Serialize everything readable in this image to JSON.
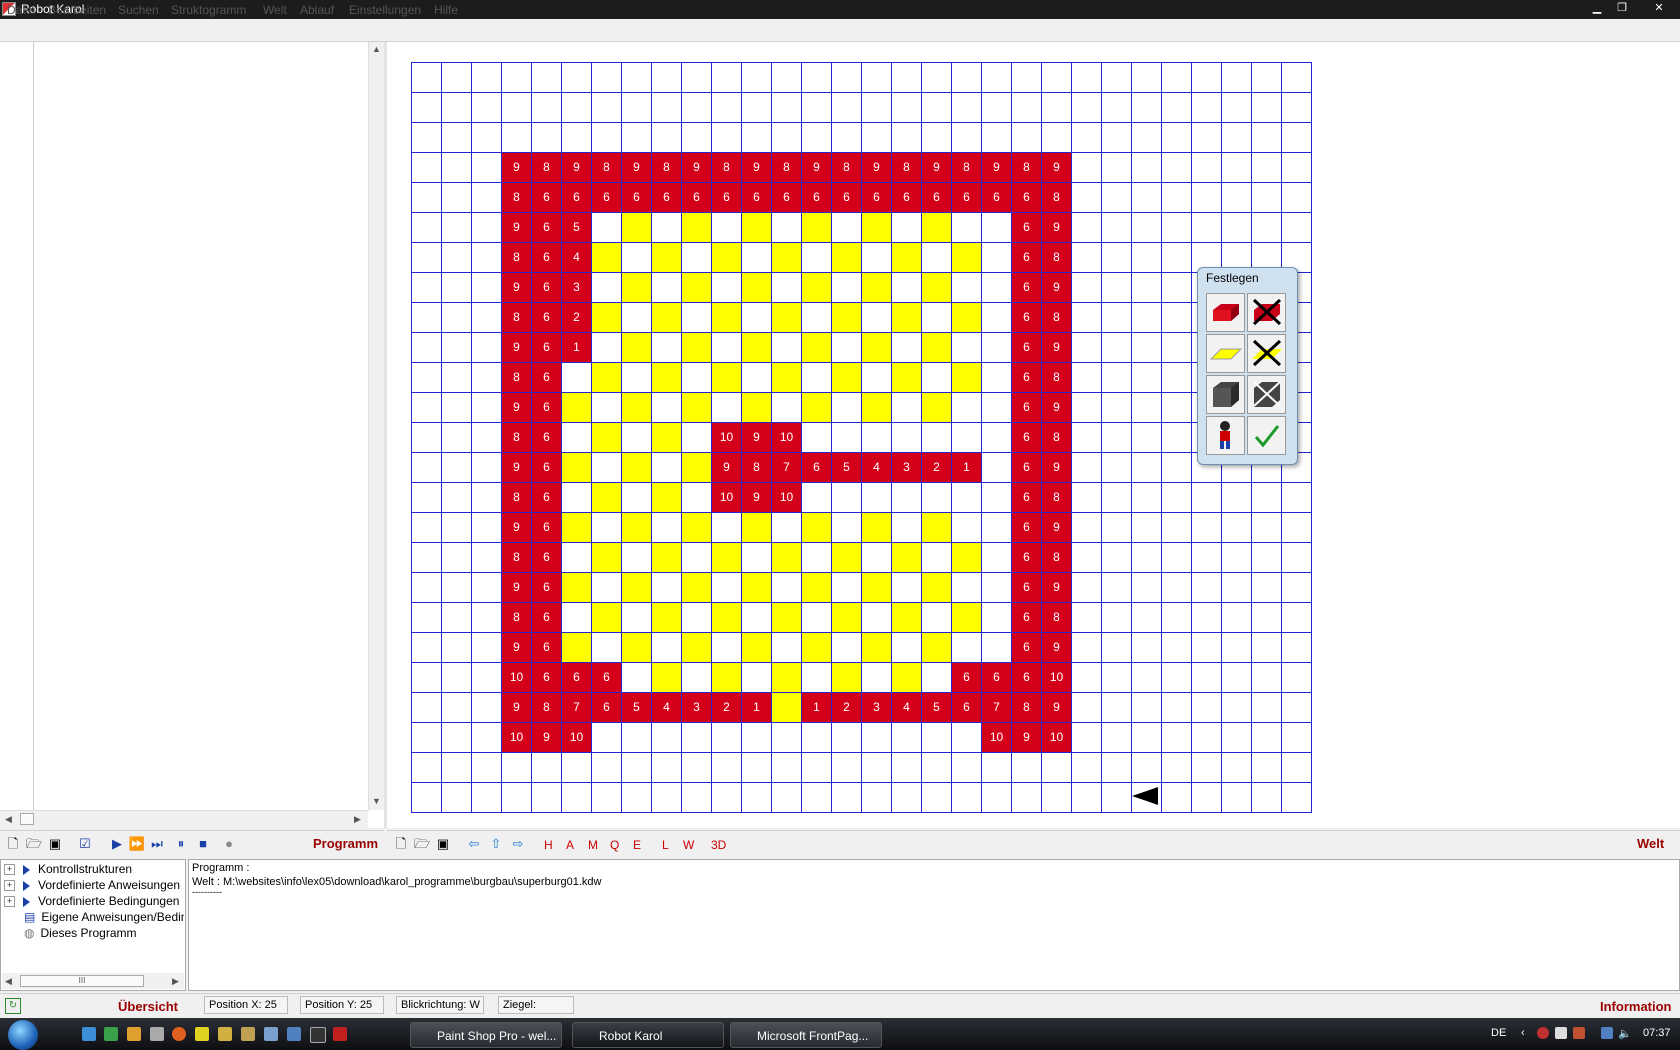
{
  "window": {
    "title": "Robot Karol",
    "min": "▁",
    "max": "❐",
    "close": "✕"
  },
  "menu": [
    "Datei",
    "Bearbeiten",
    "Suchen",
    "Struktogramm",
    "Welt",
    "Ablauf",
    "Einstellungen",
    "Hilfe"
  ],
  "world": {
    "cols": 30,
    "rows": 25,
    "grid_color": "#2424d0",
    "brick_color": "#d4001a",
    "mark_color": "#ffff00",
    "bricks": [
      {
        "row": 3,
        "values": [
          "9",
          "8",
          "9",
          "8",
          "9",
          "8",
          "9",
          "8",
          "9",
          "8",
          "9",
          "8",
          "9",
          "8",
          "9",
          "8",
          "9",
          "8",
          "9"
        ]
      },
      {
        "row": 4,
        "values": [
          "8",
          "6",
          "6",
          "6",
          "6",
          "6",
          "6",
          "6",
          "6",
          "6",
          "6",
          "6",
          "6",
          "6",
          "6",
          "6",
          "6",
          "6",
          "8"
        ]
      },
      {
        "row": 5,
        "left": [
          "9",
          "6",
          "5"
        ],
        "right": [
          "6",
          "9"
        ]
      },
      {
        "row": 6,
        "left": [
          "8",
          "6",
          "4"
        ],
        "right": [
          "6",
          "8"
        ]
      },
      {
        "row": 7,
        "left": [
          "9",
          "6",
          "3"
        ],
        "right": [
          "6",
          "9"
        ]
      },
      {
        "row": 8,
        "left": [
          "8",
          "6",
          "2"
        ],
        "right": [
          "6",
          "8"
        ]
      },
      {
        "row": 9,
        "left": [
          "9",
          "6",
          "1"
        ],
        "right": [
          "6",
          "9"
        ]
      },
      {
        "row": 10,
        "left": [
          "8",
          "6"
        ],
        "right": [
          "6",
          "8"
        ]
      },
      {
        "row": 11,
        "left": [
          "9",
          "6"
        ],
        "right": [
          "6",
          "9"
        ]
      },
      {
        "row": 12,
        "left": [
          "8",
          "6"
        ],
        "right": [
          "6",
          "8"
        ],
        "center": [
          "10",
          "9",
          "10"
        ]
      },
      {
        "row": 13,
        "left": [
          "9",
          "6"
        ],
        "right": [
          "6",
          "9"
        ],
        "center": [
          "9",
          "8",
          "7",
          "6",
          "5",
          "4",
          "3",
          "2",
          "1"
        ]
      },
      {
        "row": 14,
        "left": [
          "8",
          "6"
        ],
        "right": [
          "6",
          "8"
        ],
        "center": [
          "10",
          "9",
          "10"
        ]
      },
      {
        "row": 15,
        "left": [
          "9",
          "6"
        ],
        "right": [
          "6",
          "9"
        ]
      },
      {
        "row": 16,
        "left": [
          "8",
          "6"
        ],
        "right": [
          "6",
          "8"
        ]
      },
      {
        "row": 17,
        "left": [
          "9",
          "6"
        ],
        "right": [
          "6",
          "9"
        ]
      },
      {
        "row": 18,
        "left": [
          "8",
          "6"
        ],
        "right": [
          "6",
          "8"
        ]
      },
      {
        "row": 19,
        "left": [
          "9",
          "6"
        ],
        "right": [
          "6",
          "9"
        ]
      },
      {
        "row": 20,
        "left": [
          "10",
          "6",
          "6",
          "6"
        ],
        "right": [
          "6",
          "6",
          "6",
          "10"
        ]
      },
      {
        "row": 21,
        "left": [
          "9",
          "8",
          "7",
          "6",
          "5",
          "4",
          "3",
          "2",
          "1"
        ],
        "right": [
          "1",
          "2",
          "3",
          "4",
          "5",
          "6",
          "7",
          "8",
          "9"
        ]
      },
      {
        "row": 22,
        "left": [
          "10",
          "9",
          "10"
        ],
        "right": [
          "10",
          "9",
          "10"
        ]
      }
    ]
  },
  "festlegen": {
    "title": "Festlegen",
    "buttons": [
      "brick-icon",
      "delete-brick-icon",
      "mark-icon",
      "delete-mark-icon",
      "cube-icon",
      "delete-cube-icon",
      "robot-icon",
      "confirm-check-icon"
    ]
  },
  "toolbar": {
    "programm_label": "Programm",
    "welt_label": "Welt",
    "letters": [
      "H",
      "A",
      "M",
      "Q",
      "E",
      "L",
      "W"
    ],
    "label_3d": "3D"
  },
  "tree": {
    "items": [
      "Kontrollstrukturen",
      "Vordefinierte Anweisungen",
      "Vordefinierte Bedingungen",
      "Eigene Anweisungen/Bedingungen",
      "Dieses Programm"
    ],
    "scroll_mark": "III"
  },
  "info": {
    "line1": "Programm :",
    "line2": "Welt : M:\\websites\\info\\lex05\\download\\karol_programme\\burgbau\\superburg01.kdw",
    "line3": "----------"
  },
  "status": {
    "uebersicht": "Übersicht",
    "pos_x": "Position X:  25",
    "pos_y": "Position Y:  25",
    "blick": "Blickrichtung:  W",
    "ziegel": "Ziegel:",
    "information": "Information"
  },
  "taskbar": {
    "tasks": [
      "Paint Shop Pro - wel...",
      "Robot Karol",
      "Microsoft FrontPag..."
    ],
    "lang": "DE",
    "clock": "07:37"
  }
}
